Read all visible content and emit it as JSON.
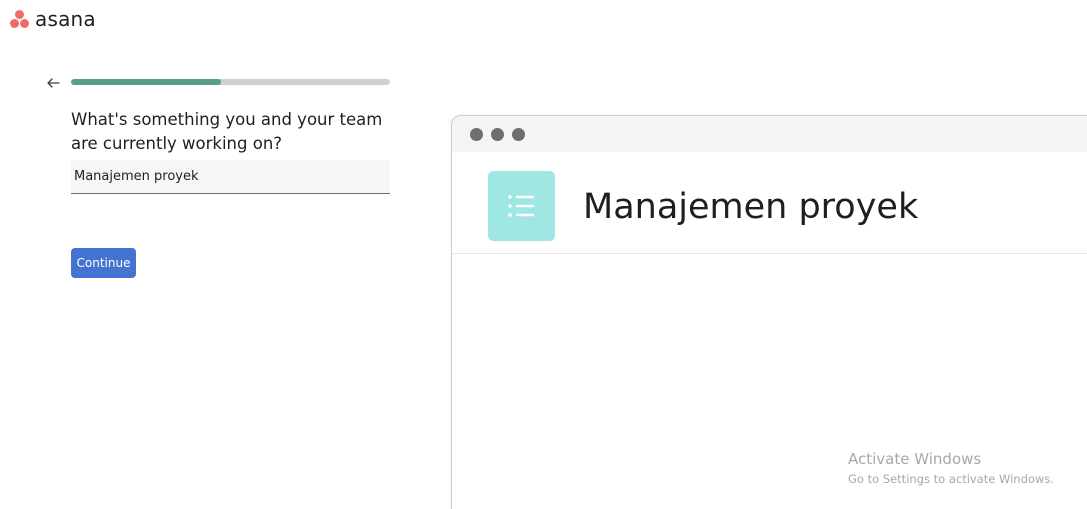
{
  "app": {
    "logo_text": "asana",
    "brand_color": "#f06a6a"
  },
  "onboarding": {
    "progress": 0.47,
    "question": "What's something you and your team are currently working on?",
    "answer_value": "Manajemen proyek",
    "continue_label": "Continue",
    "accent_color": "#4573d2",
    "progress_color": "#58a182"
  },
  "preview": {
    "project_name": "Manajemen proyek",
    "project_icon": "list-icon",
    "icon_color": "#9ee7e3"
  },
  "watermark": {
    "title": "Activate Windows",
    "subtitle": "Go to Settings to activate Windows."
  }
}
